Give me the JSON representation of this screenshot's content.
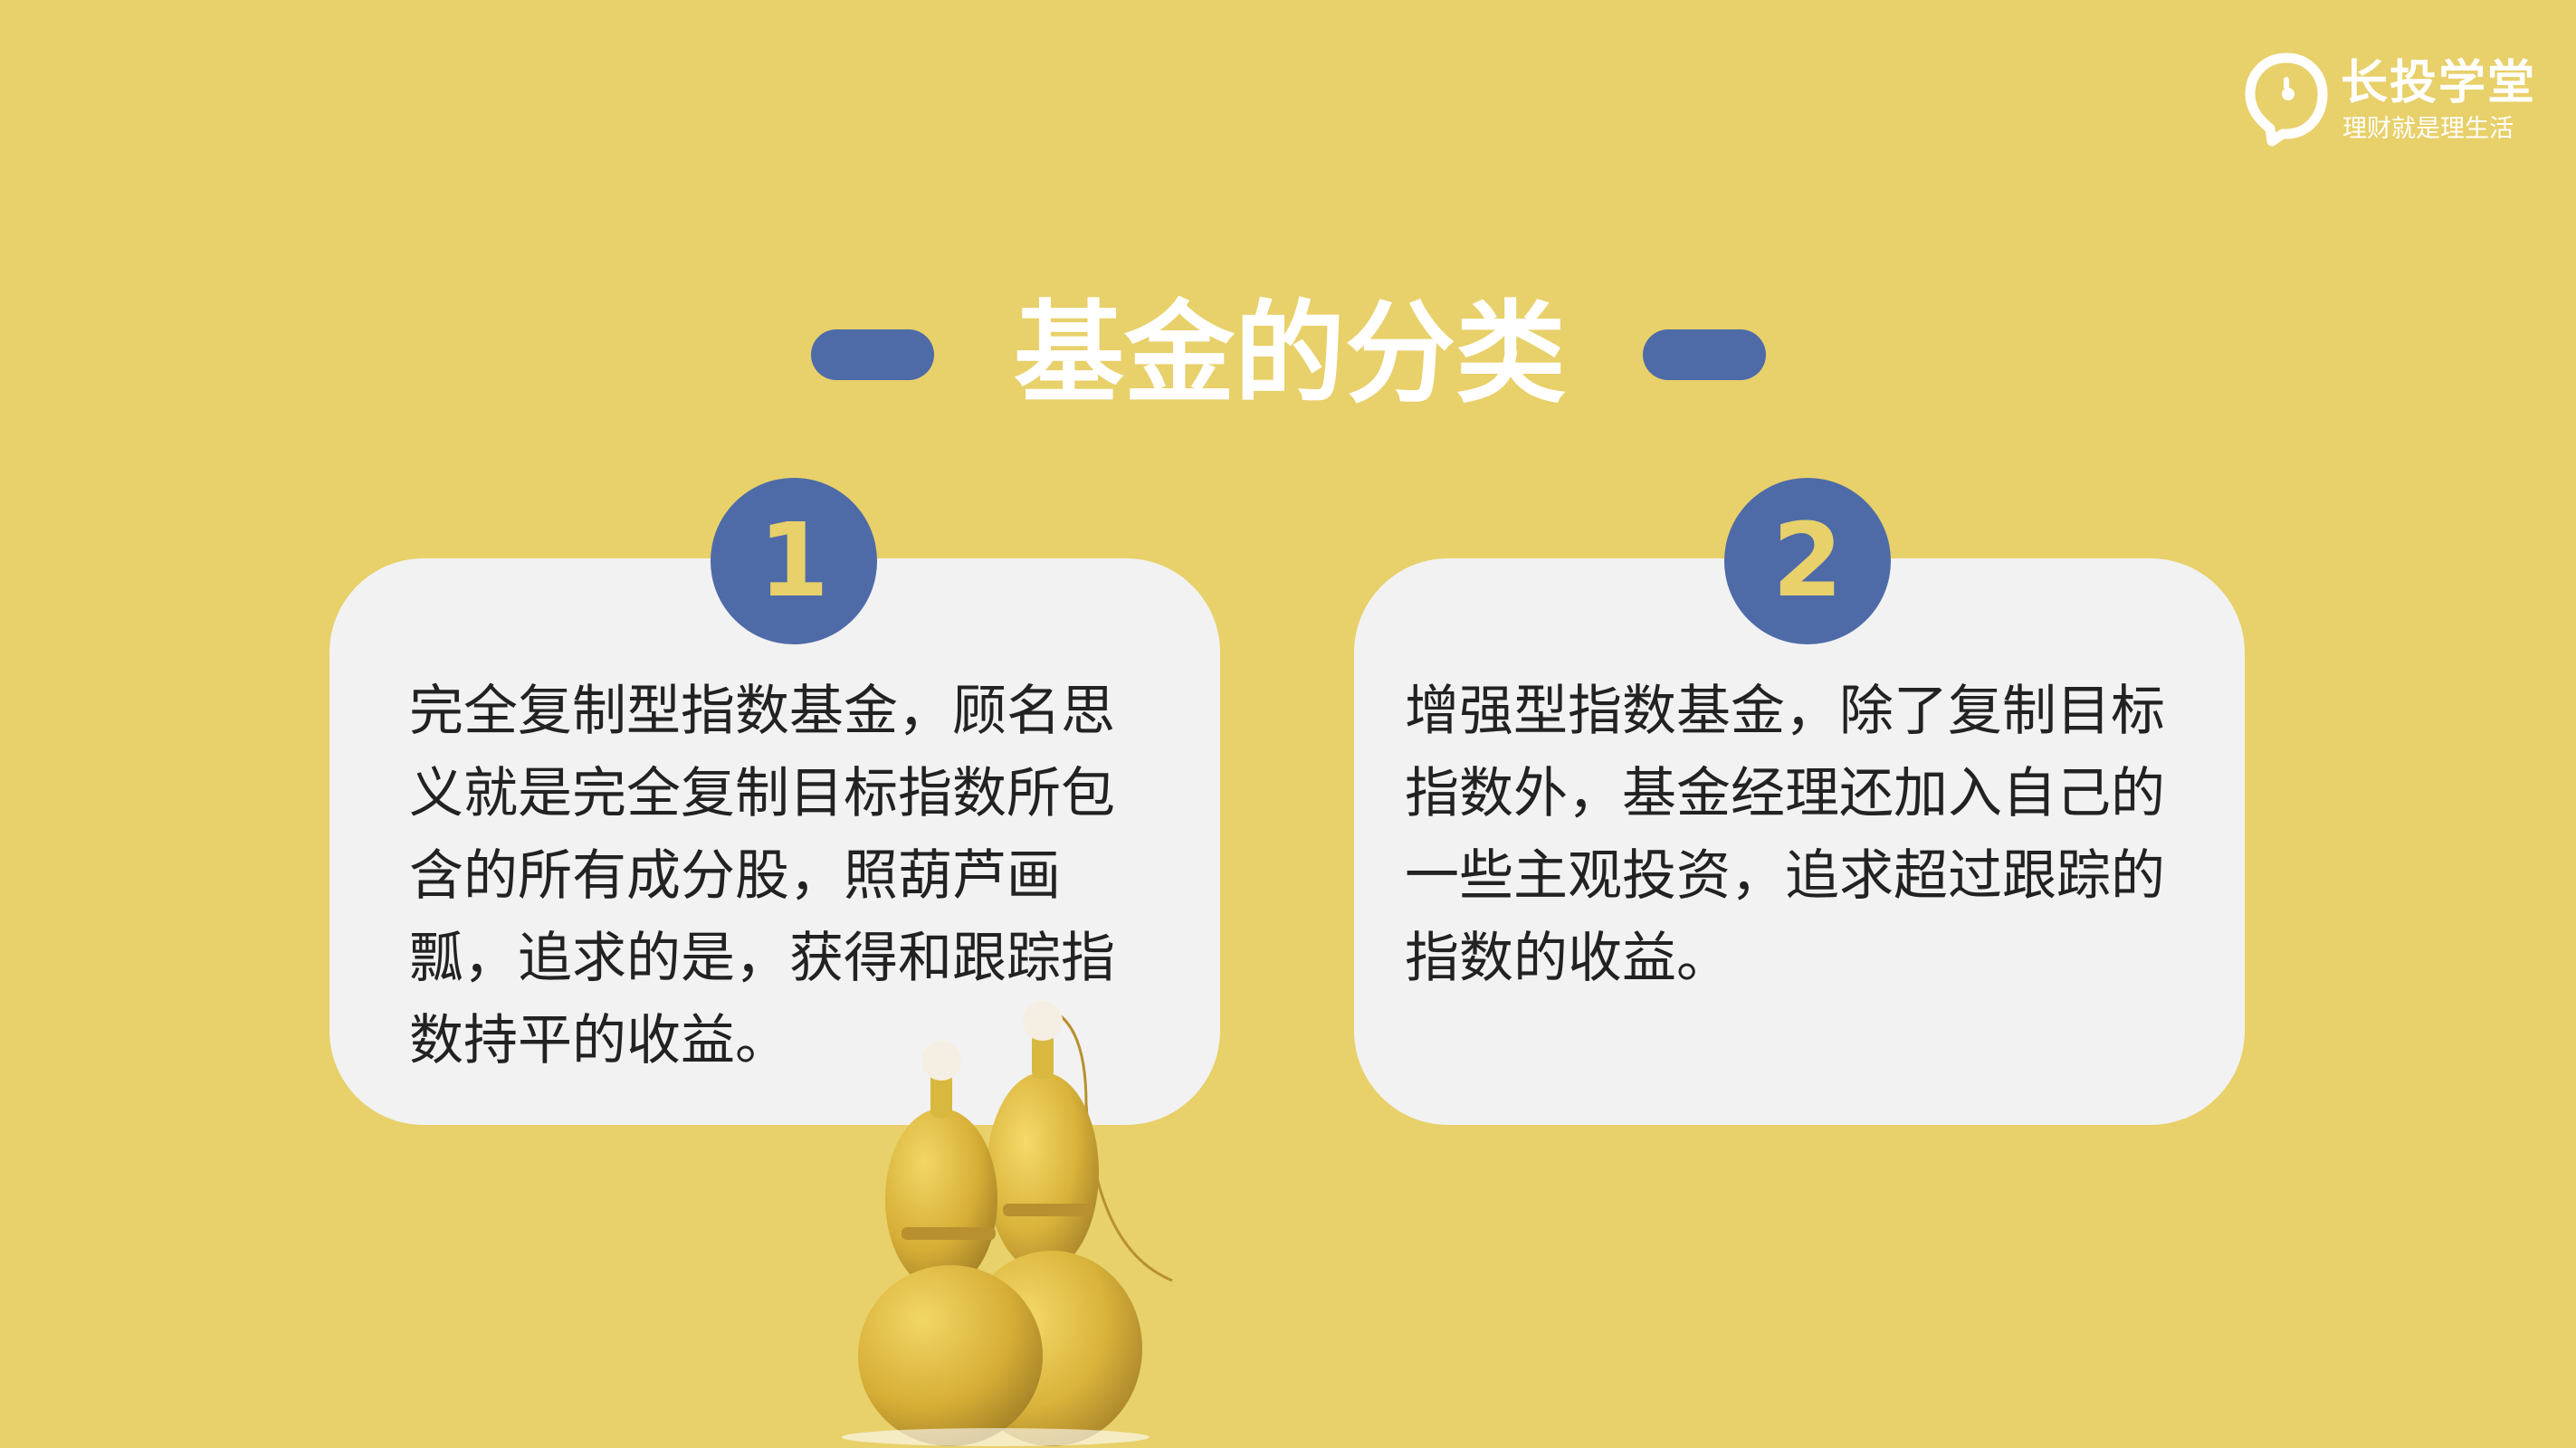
{
  "logo": {
    "title": "长投学堂",
    "subtitle": "理财就是理生活",
    "icon": "lightbulb-speech-icon"
  },
  "title": "基金的分类",
  "cards": [
    {
      "number": "1",
      "text": "完全复制型指数基金，顾名思义就是完全复制目标指数所包含的所有成分股，照葫芦画瓢，追求的是，获得和跟踪指数持平的收益。"
    },
    {
      "number": "2",
      "text": "增强型指数基金，除了复制目标指数外，基金经理还加入自己的一些主观投资，追求超过跟踪的指数的收益。"
    }
  ],
  "colors": {
    "background": "#E8D06A",
    "accent_blue": "#4E6BA8",
    "card": "#F2F2F2",
    "title": "#FFFFFF"
  },
  "illustration": "gourds-image"
}
